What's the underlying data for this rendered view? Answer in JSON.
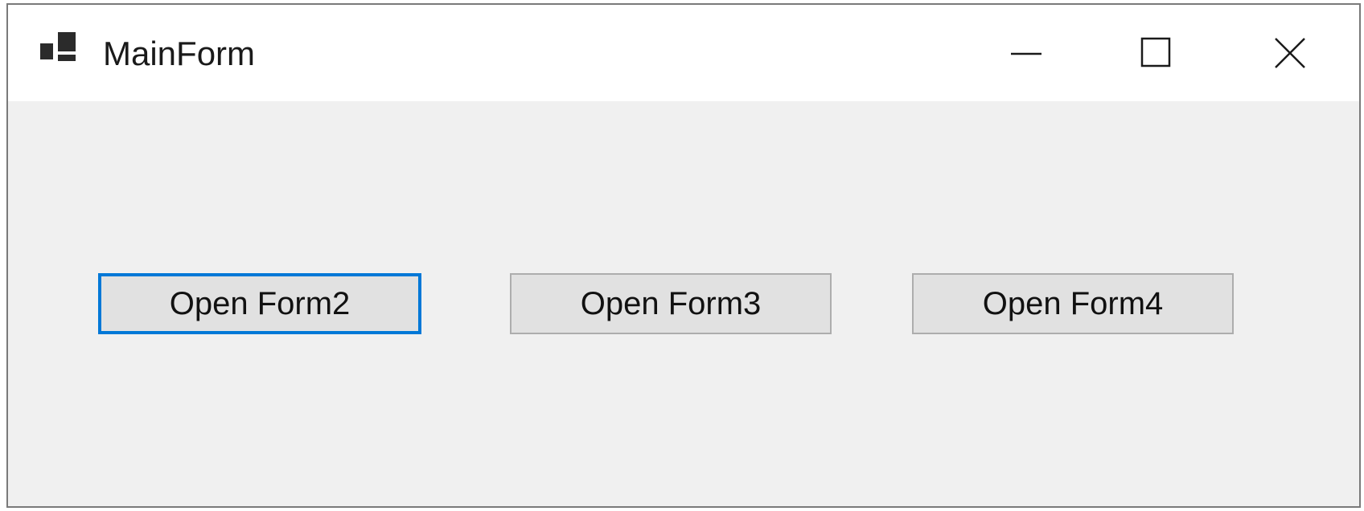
{
  "window": {
    "title": "MainForm",
    "icon": "app-window-icon",
    "controls": {
      "minimize_icon": "minimize-icon",
      "maximize_icon": "maximize-icon",
      "close_icon": "close-icon"
    }
  },
  "buttons": [
    {
      "label": "Open Form2",
      "focused": true
    },
    {
      "label": "Open Form3",
      "focused": false
    },
    {
      "label": "Open Form4",
      "focused": false
    }
  ],
  "colors": {
    "focus_border": "#0078d7",
    "button_face": "#e1e1e1",
    "button_border": "#adadad",
    "client_background": "#f0f0f0",
    "titlebar_background": "#ffffff"
  }
}
